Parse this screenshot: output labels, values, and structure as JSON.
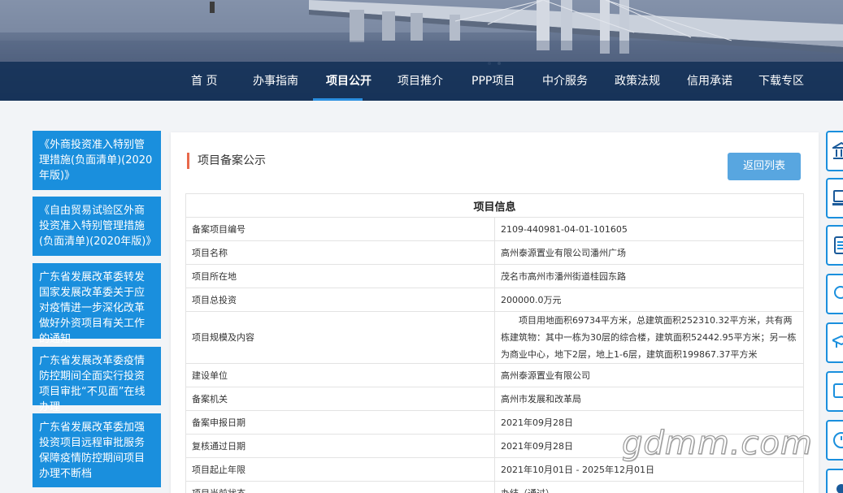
{
  "nav": {
    "items": [
      {
        "label": "首 页"
      },
      {
        "label": "办事指南"
      },
      {
        "label": "项目公开",
        "active": true
      },
      {
        "label": "项目推介"
      },
      {
        "label": "PPP项目"
      },
      {
        "label": "中介服务"
      },
      {
        "label": "政策法规"
      },
      {
        "label": "信用承诺"
      },
      {
        "label": "下载专区"
      }
    ]
  },
  "sidebar": {
    "items": [
      {
        "label": "《外商投资准入特别管理措施(负面清单)(2020年版)》"
      },
      {
        "label": "《自由贸易试验区外商投资准入特别管理措施(负面清单)(2020年版)》"
      },
      {
        "label": "广东省发展改革委转发国家发展改革委关于应对疫情进一步深化改革做好外资项目有关工作的通知"
      },
      {
        "label": "广东省发展改革委疫情防控期间全面实行投资项目审批“不见面”在线办理"
      },
      {
        "label": "广东省发展改革委加强投资项目远程审批服务保障疫情防控期间项目办理不断档"
      }
    ]
  },
  "main": {
    "section_title": "项目备案公示",
    "back_label": "返回列表",
    "table_title": "项目信息",
    "rows": [
      {
        "label": "备案项目编号",
        "value": "2109-440981-04-01-101605"
      },
      {
        "label": "项目名称",
        "value": "高州泰源置业有限公司潘州广场"
      },
      {
        "label": "项目所在地",
        "value": "茂名市高州市潘州街道桂园东路"
      },
      {
        "label": "项目总投资",
        "value": "200000.0万元"
      },
      {
        "label": "项目规模及内容",
        "value": "项目用地面积69734平方米，总建筑面积252310.32平方米，共有两栋建筑物：其中一栋为30层的综合楼，建筑面积52442.95平方米；另一栋为商业中心，地下2层，地上1-6层，建筑面积199867.37平方米",
        "tall": true
      },
      {
        "label": "建设单位",
        "value": "高州泰源置业有限公司"
      },
      {
        "label": "备案机关",
        "value": "高州市发展和改革局"
      },
      {
        "label": "备案申报日期",
        "value": "2021年09月28日"
      },
      {
        "label": "复核通过日期",
        "value": "2021年09月28日"
      },
      {
        "label": "项目起止年限",
        "value": "2021年10月01日 - 2025年12月01日"
      },
      {
        "label": "项目当前状态",
        "value": "办结（通过）"
      }
    ]
  },
  "right_bar": {
    "icons": [
      "bank-icon",
      "computer-icon",
      "document-list-icon",
      "search-icon",
      "graduation-cap-icon",
      "chat-icon",
      "clock-icon",
      "gear-icon"
    ]
  },
  "watermark": {
    "text": "gdmm.com"
  },
  "colors": {
    "nav_bg": "#123056",
    "accent": "#1a8fdd",
    "button": "#58a6e0",
    "section_marker": "#e8694b"
  }
}
